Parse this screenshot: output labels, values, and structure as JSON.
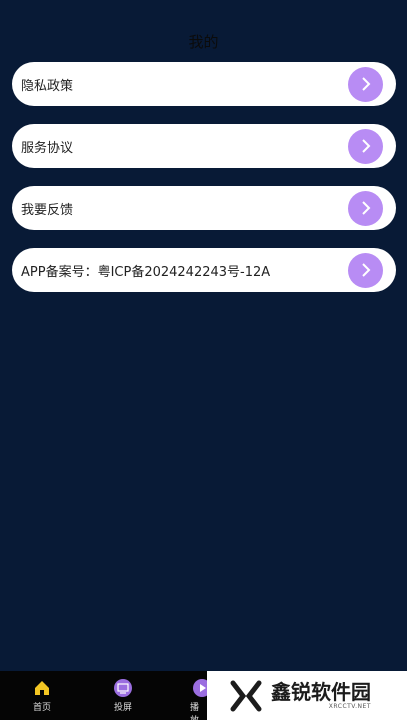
{
  "header": {
    "title": "我的"
  },
  "menu": [
    {
      "label": "隐私政策"
    },
    {
      "label": "服务协议"
    },
    {
      "label": "我要反馈"
    },
    {
      "label": "APP备案号：粤ICP备2024242243号-12A"
    }
  ],
  "tabbar": {
    "tabs": [
      {
        "label": "首页",
        "icon": "home-icon"
      },
      {
        "label": "投屏",
        "icon": "screen-cast-icon"
      },
      {
        "label": "播放",
        "icon": "play-icon"
      }
    ]
  },
  "watermark": {
    "name": "鑫锐软件园",
    "site": "XRCCTV.NET"
  },
  "colors": {
    "background": "#081a36",
    "accent": "#b88cf4",
    "card": "#ffffff",
    "tab_icon": "#9b6ee0"
  }
}
